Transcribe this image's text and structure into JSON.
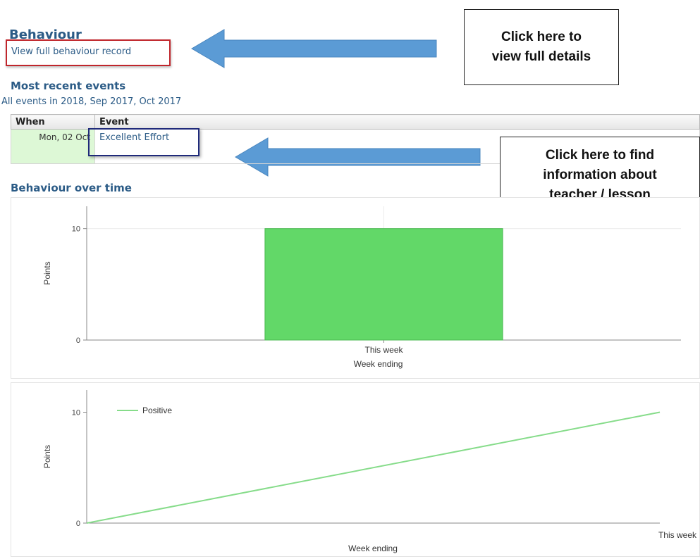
{
  "behaviour": {
    "title": "Behaviour",
    "full_record_link": "View full behaviour record"
  },
  "callouts": {
    "top": "Click here to\nview full details",
    "middle": "Click here to find\ninformation about\nteacher / lesson"
  },
  "recent": {
    "heading": "Most recent events",
    "filter_text": "All events in 2018, Sep 2017, Oct 2017",
    "columns": [
      "When",
      "Event"
    ],
    "rows": [
      {
        "when": "Mon, 02 Oct",
        "event": "Excellent Effort"
      }
    ]
  },
  "over_time": {
    "heading": "Behaviour over time"
  },
  "colors": {
    "bar": "#62d868",
    "line": "#86dc8a",
    "link": "#2b5b86",
    "highlight_red": "#c0262c",
    "highlight_blue": "#1f2a7a",
    "arrow": "#5b9bd5"
  },
  "chart_data": [
    {
      "type": "bar",
      "categories": [
        "This week"
      ],
      "values": [
        10
      ],
      "xlabel": "Week ending",
      "ylabel": "Points",
      "yticks": [
        0,
        10
      ],
      "ylim": [
        0,
        12
      ],
      "grid": true
    },
    {
      "type": "line",
      "x": [
        "",
        "This week"
      ],
      "series": [
        {
          "name": "Positive",
          "values": [
            0,
            10
          ]
        }
      ],
      "xlabel": "Week ending",
      "ylabel": "Points",
      "yticks": [
        0,
        10
      ],
      "ylim": [
        0,
        12
      ],
      "legend": "top-left",
      "grid": false
    }
  ]
}
